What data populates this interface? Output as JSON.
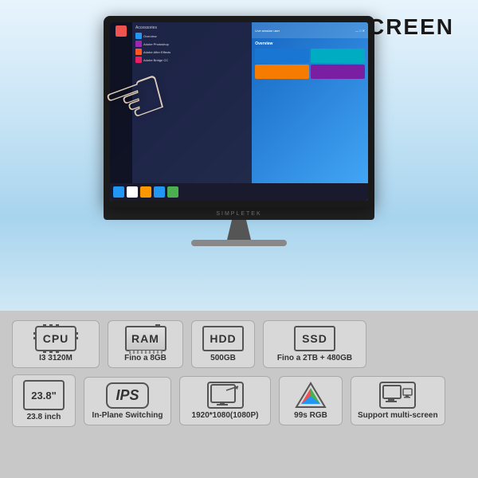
{
  "header": {
    "touch_screen_label": "TOUCH SCREEN"
  },
  "monitor": {
    "brand": "SIMPLETEK",
    "screen_content": {
      "menu_header": "Accessories",
      "user_label": "Live session user",
      "right_panel_title": "Overview"
    }
  },
  "specs_row1": [
    {
      "icon_label": "CPU",
      "value": "I3 3120M",
      "name": "cpu-spec"
    },
    {
      "icon_label": "RAM",
      "value": "Fino a 8GB",
      "name": "ram-spec"
    },
    {
      "icon_label": "HDD",
      "value": "500GB",
      "name": "hdd-spec"
    },
    {
      "icon_label": "SSD",
      "value": "Fino a 2TB + 480GB",
      "name": "ssd-spec"
    }
  ],
  "specs_row2": [
    {
      "icon_label": "23.8\"",
      "value": "23.8 inch",
      "name": "size-spec"
    },
    {
      "icon_label": "IPS",
      "value": "In-Plane Switching",
      "name": "ips-spec"
    },
    {
      "icon_label": "1920×1080",
      "value": "1920*1080(1080P)",
      "name": "resolution-spec"
    },
    {
      "icon_label": "99%sRGB",
      "value": "99s RGB",
      "name": "color-spec"
    },
    {
      "icon_label": "multi",
      "value": "Support multi-screen",
      "name": "multiscreen-spec"
    }
  ]
}
